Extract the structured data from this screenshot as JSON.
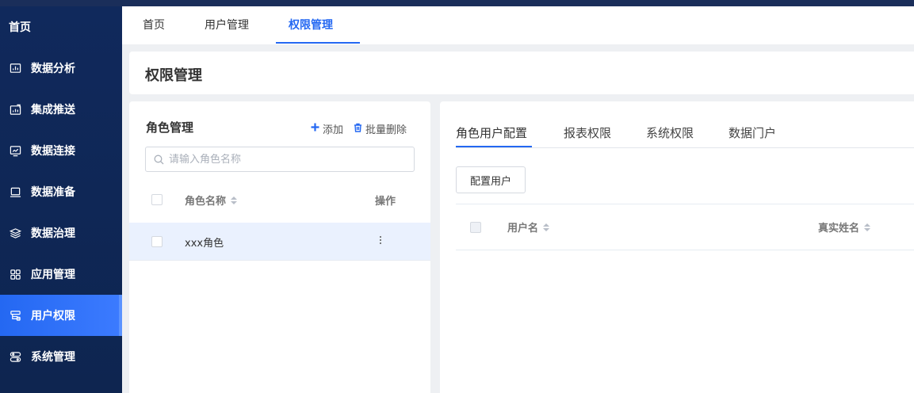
{
  "sidebar": {
    "home": "首页",
    "items": [
      {
        "label": "数据分析",
        "icon": "chart-icon"
      },
      {
        "label": "集成推送",
        "icon": "push-chart-icon"
      },
      {
        "label": "数据连接",
        "icon": "monitor-connect-icon"
      },
      {
        "label": "数据准备",
        "icon": "laptop-icon"
      },
      {
        "label": "数据治理",
        "icon": "layers-icon"
      },
      {
        "label": "应用管理",
        "icon": "apps-grid-icon"
      },
      {
        "label": "用户权限",
        "icon": "user-permission-icon",
        "active": true
      },
      {
        "label": "系统管理",
        "icon": "system-settings-icon"
      }
    ]
  },
  "header": {
    "tabs": [
      {
        "label": "首页"
      },
      {
        "label": "用户管理"
      },
      {
        "label": "权限管理",
        "active": true
      }
    ]
  },
  "page": {
    "title": "权限管理"
  },
  "role_panel": {
    "title": "角色管理",
    "add_label": "添加",
    "batch_delete_label": "批量删除",
    "search_placeholder": "请输入角色名称",
    "columns": {
      "name": "角色名称",
      "actions": "操作"
    },
    "rows": [
      {
        "name": "xxx角色"
      }
    ]
  },
  "config_panel": {
    "tabs": [
      {
        "label": "角色用户配置",
        "active": true
      },
      {
        "label": "报表权限"
      },
      {
        "label": "系统权限"
      },
      {
        "label": "数据门户"
      }
    ],
    "config_button": "配置用户",
    "columns": {
      "username": "用户名",
      "realname": "真实姓名"
    }
  },
  "colors": {
    "accent": "#2468f2",
    "sidebar_bg": "#10295c",
    "row_highlight": "#eaf1fe"
  }
}
